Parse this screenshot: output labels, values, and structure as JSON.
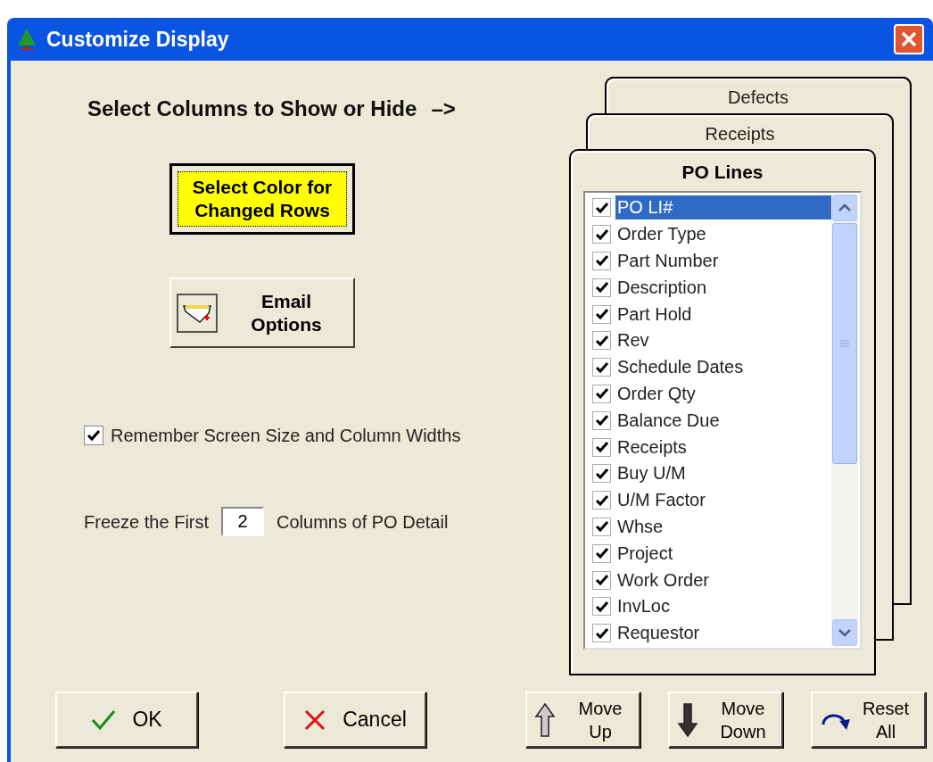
{
  "window": {
    "title": "Customize Display"
  },
  "heading": {
    "text": "Select Columns to Show or Hide",
    "arrow": "–>"
  },
  "color_button": {
    "label": "Select Color for Changed Rows",
    "color": "#ffff00"
  },
  "email_button": {
    "label": "Email Options"
  },
  "remember": {
    "label": "Remember Screen Size and Column Widths",
    "checked": true
  },
  "freeze": {
    "prefix": "Freeze the First",
    "value": "2",
    "suffix": "Columns of PO Detail"
  },
  "tabs": [
    {
      "label": "Defects",
      "selected": false
    },
    {
      "label": "Receipts",
      "selected": false
    },
    {
      "label": "PO Lines",
      "selected": true
    }
  ],
  "columns": [
    {
      "label": "PO LI#",
      "checked": true,
      "selected": true
    },
    {
      "label": "Order Type",
      "checked": true,
      "selected": false
    },
    {
      "label": "Part Number",
      "checked": true,
      "selected": false
    },
    {
      "label": "Description",
      "checked": true,
      "selected": false
    },
    {
      "label": "Part Hold",
      "checked": true,
      "selected": false
    },
    {
      "label": "Rev",
      "checked": true,
      "selected": false
    },
    {
      "label": "Schedule Dates",
      "checked": true,
      "selected": false
    },
    {
      "label": "Order Qty",
      "checked": true,
      "selected": false
    },
    {
      "label": "Balance Due",
      "checked": true,
      "selected": false
    },
    {
      "label": "Receipts",
      "checked": true,
      "selected": false
    },
    {
      "label": "Buy U/M",
      "checked": true,
      "selected": false
    },
    {
      "label": "U/M Factor",
      "checked": true,
      "selected": false
    },
    {
      "label": "Whse",
      "checked": true,
      "selected": false
    },
    {
      "label": "Project",
      "checked": true,
      "selected": false
    },
    {
      "label": "Work Order",
      "checked": true,
      "selected": false
    },
    {
      "label": "InvLoc",
      "checked": true,
      "selected": false
    },
    {
      "label": "Requestor",
      "checked": true,
      "selected": false
    }
  ],
  "bottom_buttons": [
    {
      "kind": "ok",
      "label": "OK"
    },
    {
      "kind": "cancel",
      "label": "Cancel"
    },
    {
      "kind": "up",
      "label": "Move Up"
    },
    {
      "kind": "down",
      "label": "Move Down"
    },
    {
      "kind": "reset",
      "label": "Reset All"
    }
  ]
}
